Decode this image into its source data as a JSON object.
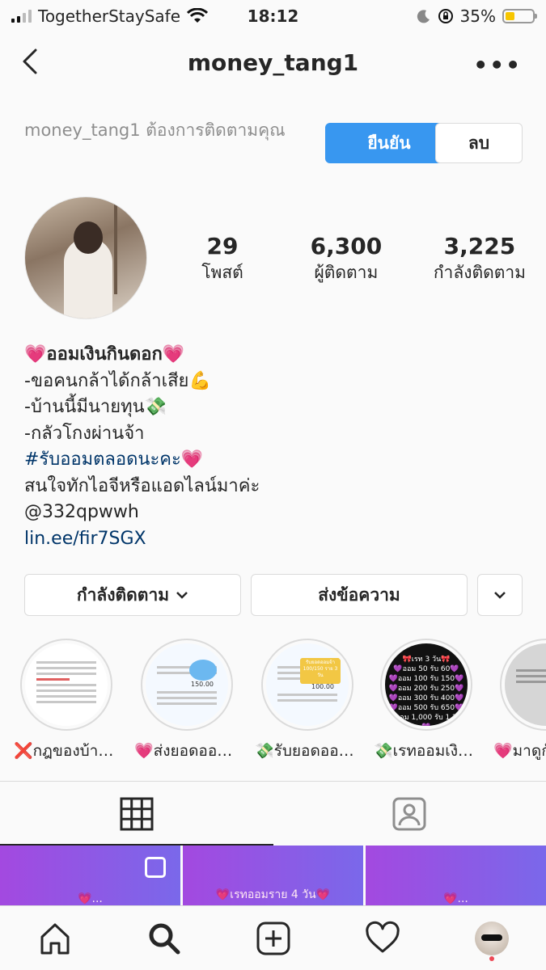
{
  "status_bar": {
    "carrier": "TogetherStaySafe",
    "time": "18:12",
    "battery_percent": "35%",
    "battery_level": 0.35,
    "icons": [
      "signal-icon",
      "wifi-icon",
      "moon-icon",
      "orientation-lock-icon",
      "battery-icon"
    ]
  },
  "navbar": {
    "title": "money_tang1",
    "back_icon": "chevron-left-icon",
    "more_icon": "more-horizontal-icon"
  },
  "follow_request": {
    "text": "money_tang1 ต้องการติดตามคุณ",
    "confirm_label": "ยืนยัน",
    "delete_label": "ลบ"
  },
  "profile": {
    "stats": [
      {
        "value": "29",
        "label": "โพสต์"
      },
      {
        "value": "6,300",
        "label": "ผู้ติดตาม"
      },
      {
        "value": "3,225",
        "label": "กำลังติดตาม"
      }
    ],
    "bio": {
      "name_line": "💗ออมเงินกินดอก💗",
      "lines": [
        "-ขอคนกล้าได้กล้าเสีย💪",
        "-บ้านนี้มีนายทุน💸",
        "-กลัวโกงผ่านจ้า"
      ],
      "hashtag_line": "#รับออมตลอดนะคะ💗",
      "contact_line": "สนใจทักไอจีหรือแอดไลน์มาค่ะ",
      "line_id": "@332qpwwh",
      "link": "lin.ee/fir7SGX"
    }
  },
  "actions": {
    "following_label": "กำลังติดตาม",
    "message_label": "ส่งข้อความ"
  },
  "highlights": [
    {
      "label": "❌กฎของบ้าน..."
    },
    {
      "label": "💗ส่งยอดออม..."
    },
    {
      "label": "💸รับยอดออม..."
    },
    {
      "label": "💸เรทออมเงิน...",
      "rates_title": "🎀เรท 3 วัน🎀",
      "rates": [
        "💜ออม 50 รับ 60💜",
        "💜ออม 100 รับ 150💜",
        "💜ออม 200 รับ 250💜",
        "💜ออม 300 รับ 400💜",
        "💜ออม 500 รับ 650💜",
        "💜ออม 1,000 รับ 1,200💜"
      ]
    },
    {
      "label": "💗มาดูกัน"
    }
  ],
  "highlight_snippets": {
    "receive_badge": "รับยอดออมจ้า 100/150 ราย 3 วัน",
    "amount_1": "150.00",
    "amount_2": "100.00"
  },
  "tabs": {
    "grid_icon": "grid-icon",
    "tagged_icon": "tagged-person-icon"
  },
  "grid": [
    {
      "caption": "💗..."
    },
    {
      "caption": "💗เรทออมราย 4 วัน💗"
    },
    {
      "caption": "💗..."
    }
  ],
  "bottom_bar": {
    "icons": [
      "home-icon",
      "search-icon",
      "add-post-icon",
      "heart-icon",
      "profile-avatar"
    ]
  }
}
